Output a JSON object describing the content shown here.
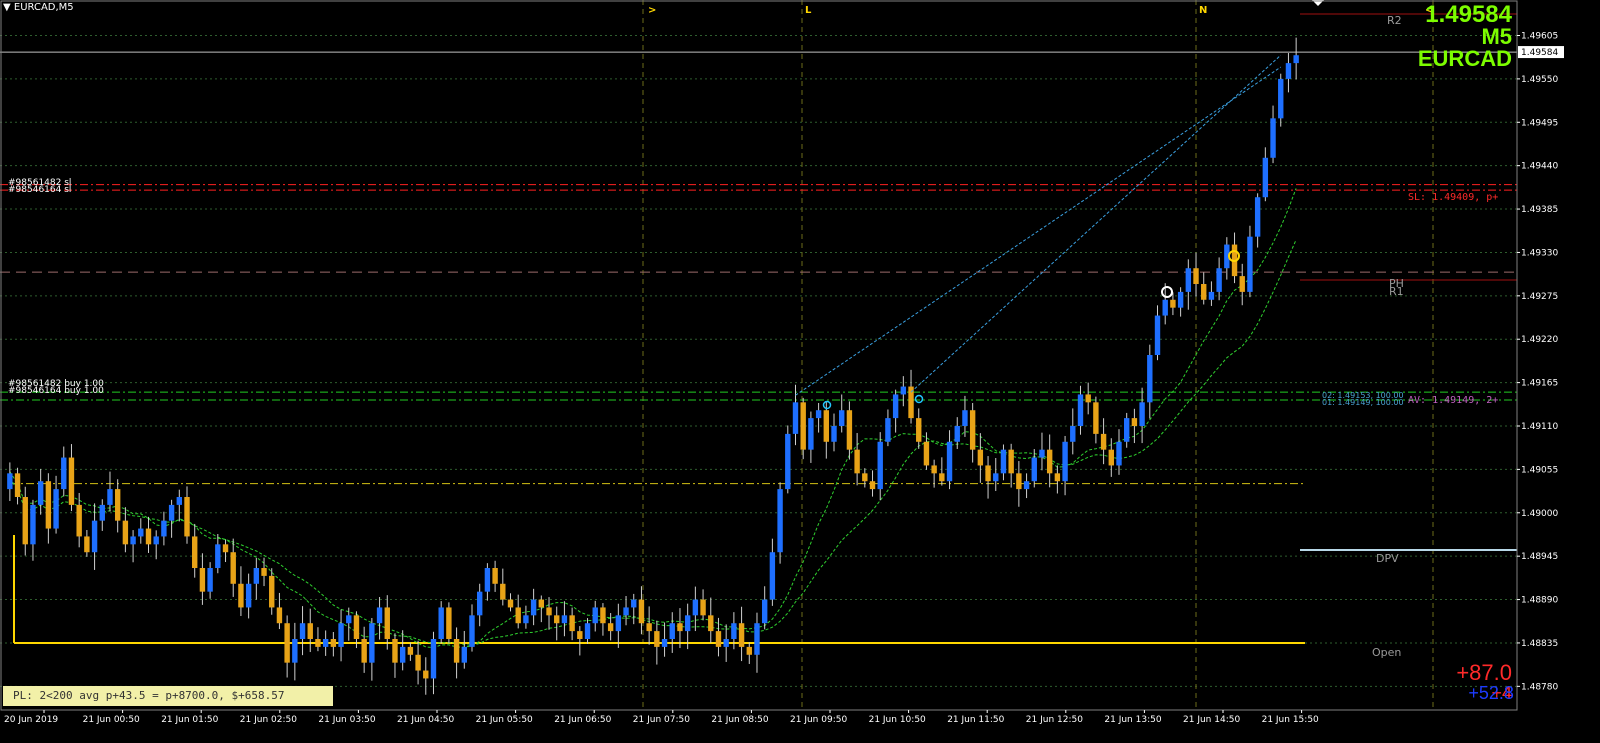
{
  "window": {
    "symbol_label": "EURCAD,M5"
  },
  "overlay": {
    "big_price": "1.49584",
    "big_timeframe": "M5",
    "big_symbol": "EURCAD",
    "pl_text": "PL: 2<200 avg p+43.5 = p+8700.0, $+658.57",
    "pnl_top": "+87.0",
    "pnl_bottom_red": "+4",
    "pnl_bottom_blue": "+52.8"
  },
  "markers": {
    "top": [
      ">",
      "L",
      "N",
      "<"
    ]
  },
  "levels": {
    "r2": "R2",
    "r1": "R1",
    "ph": "PH",
    "dpv": "DPV",
    "open": "Open",
    "sl_text": "SL: 1.49409, p+",
    "av_text": "AV: 1.49149, 2+",
    "order_tp_a": "#98561482 sl",
    "order_tp_b": "#98546164 sl",
    "order_buy_a": "#98561482 buy 1.00",
    "order_buy_b": "#98546164 buy 1.00",
    "lot_a": "02: 1.49153, 100.00",
    "lot_b": "01: 1.49149, 100.00"
  },
  "price_axis": {
    "current": "1.49584",
    "ticks": [
      "1.49605",
      "1.49550",
      "1.49495",
      "1.49440",
      "1.49385",
      "1.49330",
      "1.49275",
      "1.49220",
      "1.49165",
      "1.49110",
      "1.49055",
      "1.49000",
      "1.48945",
      "1.48890",
      "1.48835",
      "1.48780"
    ]
  },
  "time_axis": {
    "ticks": [
      "20 Jun 2019",
      "21 Jun 00:50",
      "21 Jun 01:50",
      "21 Jun 02:50",
      "21 Jun 03:50",
      "21 Jun 04:50",
      "21 Jun 05:50",
      "21 Jun 06:50",
      "21 Jun 07:50",
      "21 Jun 08:50",
      "21 Jun 09:50",
      "21 Jun 10:50",
      "21 Jun 11:50",
      "21 Jun 12:50",
      "21 Jun 13:50",
      "21 Jun 14:50",
      "21 Jun 15:50"
    ]
  },
  "colors": {
    "bull": "#1e6fff",
    "bear": "#e8a317",
    "sl_line": "#ff2020",
    "buy_line": "#22cc22",
    "yellow_line": "#ffd700",
    "grid": "#2e5e2e",
    "price_line": "#c0c0c0"
  },
  "chart_data": {
    "type": "candlestick",
    "symbol": "EURCAD",
    "timeframe": "M5",
    "y_range": [
      1.4875,
      1.4965
    ],
    "current_price": 1.49584,
    "levels": {
      "sl": 1.49409,
      "average": 1.49149,
      "buy_1": 1.49153,
      "buy_2": 1.49149,
      "open": 1.48835,
      "ph": 1.49305
    },
    "closes": [
      1.4905,
      1.4902,
      1.4896,
      1.4901,
      1.4904,
      1.4898,
      1.4903,
      1.4907,
      1.4901,
      1.4897,
      1.4895,
      1.4899,
      1.4901,
      1.4903,
      1.4899,
      1.4896,
      1.4897,
      1.4898,
      1.4896,
      1.4897,
      1.4899,
      1.4901,
      1.4902,
      1.4897,
      1.4893,
      1.489,
      1.4893,
      1.4896,
      1.4895,
      1.4891,
      1.4888,
      1.4891,
      1.4893,
      1.4892,
      1.4888,
      1.4886,
      1.4881,
      1.4884,
      1.4886,
      1.4884,
      1.4883,
      1.4884,
      1.4883,
      1.4886,
      1.4887,
      1.4884,
      1.4881,
      1.4886,
      1.4888,
      1.4884,
      1.4881,
      1.4883,
      1.4882,
      1.488,
      1.4879,
      1.4884,
      1.4888,
      1.4884,
      1.4881,
      1.4883,
      1.4887,
      1.489,
      1.4893,
      1.4891,
      1.4889,
      1.4888,
      1.4886,
      1.4887,
      1.4889,
      1.4888,
      1.4887,
      1.4886,
      1.4887,
      1.4885,
      1.4884,
      1.4886,
      1.4888,
      1.4886,
      1.4885,
      1.4887,
      1.4888,
      1.4889,
      1.4886,
      1.4885,
      1.4883,
      1.4884,
      1.4886,
      1.4885,
      1.4887,
      1.4889,
      1.4887,
      1.4885,
      1.4883,
      1.4884,
      1.4886,
      1.4883,
      1.4882,
      1.4886,
      1.4889,
      1.4895,
      1.4903,
      1.491,
      1.4914,
      1.4908,
      1.4912,
      1.4913,
      1.4909,
      1.4911,
      1.4913,
      1.4908,
      1.4905,
      1.4904,
      1.4903,
      1.4909,
      1.4912,
      1.4915,
      1.4916,
      1.4912,
      1.4909,
      1.4906,
      1.4905,
      1.4904,
      1.4909,
      1.4911,
      1.4913,
      1.4908,
      1.4906,
      1.4904,
      1.4905,
      1.4908,
      1.4905,
      1.4903,
      1.4904,
      1.4907,
      1.4908,
      1.4905,
      1.4904,
      1.4909,
      1.4911,
      1.4915,
      1.4914,
      1.491,
      1.4908,
      1.4906,
      1.4909,
      1.4912,
      1.4911,
      1.4914,
      1.492,
      1.4925,
      1.4927,
      1.4926,
      1.4928,
      1.4931,
      1.4929,
      1.4927,
      1.4928,
      1.4931,
      1.4934,
      1.493,
      1.4928,
      1.4935,
      1.494,
      1.4945,
      1.495,
      1.4955,
      1.4957,
      1.4958
    ]
  }
}
